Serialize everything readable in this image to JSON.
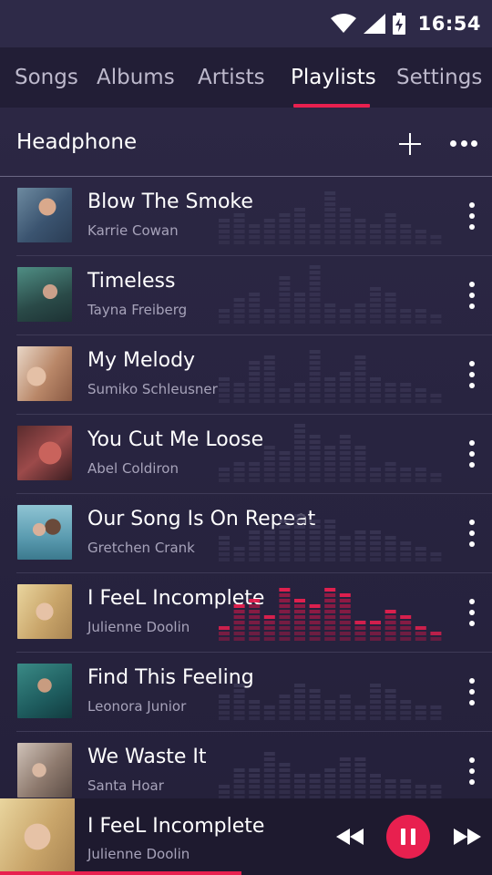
{
  "status_bar": {
    "time": "16:54",
    "icons": [
      "wifi-icon",
      "cell-signal-icon",
      "battery-charging-icon"
    ]
  },
  "tabs": [
    {
      "label": "Songs",
      "active": false
    },
    {
      "label": "Albums",
      "active": false
    },
    {
      "label": "Artists",
      "active": false
    },
    {
      "label": "Playlists",
      "active": true
    },
    {
      "label": "Settings",
      "active": false
    }
  ],
  "playlist": {
    "title": "Headphone",
    "icons": [
      "plus-icon",
      "more-horizontal-icon"
    ]
  },
  "songs": [
    {
      "title": "Blow The Smoke",
      "artist": "Karrie Cowan",
      "playing": false
    },
    {
      "title": "Timeless",
      "artist": "Tayna Freiberg",
      "playing": false
    },
    {
      "title": "My Melody",
      "artist": "Sumiko Schleusner",
      "playing": false
    },
    {
      "title": "You Cut Me Loose",
      "artist": "Abel Coldiron",
      "playing": false
    },
    {
      "title": "Our Song Is On Repeat",
      "artist": "Gretchen Crank",
      "playing": false
    },
    {
      "title": "I FeeL Incomplete",
      "artist": "Julienne Doolin",
      "playing": true
    },
    {
      "title": "Find This Feeling",
      "artist": "Leonora Junior",
      "playing": false
    },
    {
      "title": "We Waste It",
      "artist": "Santa Hoar",
      "playing": false
    }
  ],
  "now_playing": {
    "title": "I FeeL Incomplete",
    "artist": "Julienne Doolin",
    "progress": 0.49,
    "icons": [
      "rewind-icon",
      "pause-icon",
      "fast-forward-icon"
    ]
  },
  "colors": {
    "accent": "#e8204f",
    "background": "#2a2642",
    "tab_bar": "#221e36",
    "player": "#1e1a2f"
  }
}
